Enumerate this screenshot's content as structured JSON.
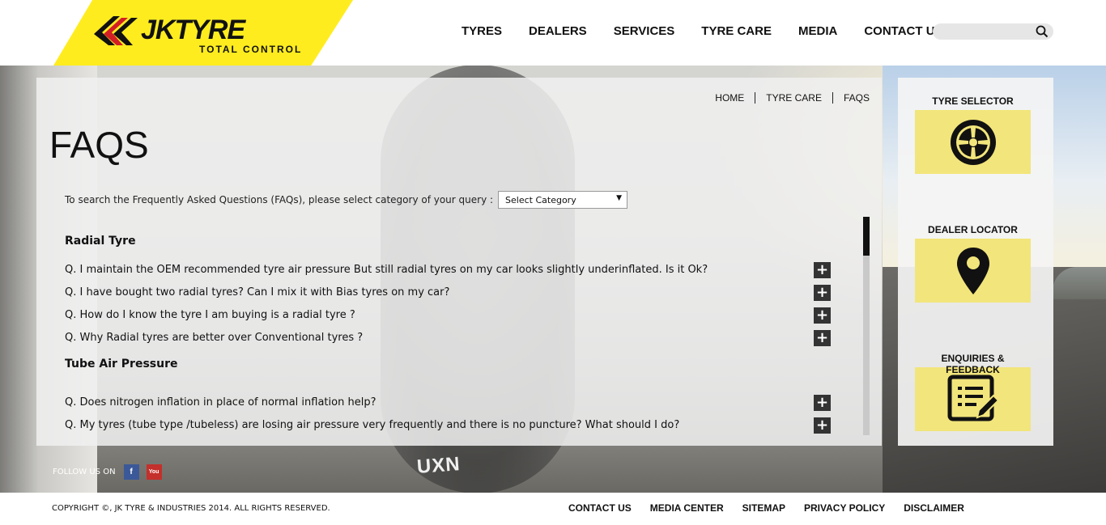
{
  "brand": {
    "name": "JKTYRE",
    "tagline": "TOTAL CONTROL",
    "accent": "#ffec1f"
  },
  "nav": {
    "items": [
      "TYRES",
      "DEALERS",
      "SERVICES",
      "TYRE CARE",
      "MEDIA",
      "CONTACT US"
    ]
  },
  "search": {
    "placeholder": "",
    "icon": "search-icon"
  },
  "breadcrumb": [
    "HOME",
    "TYRE CARE",
    "FAQS"
  ],
  "page": {
    "title": "FAQS",
    "search_prompt": "To search the Frequently Asked Questions (FAQs), please select category of your query :",
    "select_value": "Select Category"
  },
  "faq_sections": [
    {
      "title": "Radial Tyre",
      "questions": [
        "Q. I maintain the OEM recommended tyre air pressure But still radial tyres on my car looks slightly underinflated. Is it Ok?",
        "Q. I have bought two radial tyres? Can I mix it with Bias tyres on my car?",
        "Q. How do I know the tyre I am buying is a radial tyre ?",
        "Q. Why Radial tyres are better over Conventional tyres ?"
      ]
    },
    {
      "title": "Tube Air Pressure",
      "questions": [
        "Q. Does nitrogen inflation in place of normal inflation help?",
        "Q. My tyres (tube type /tubeless) are losing air pressure very frequently and there is no puncture? What should I do?"
      ]
    }
  ],
  "expand_symbol": "+",
  "sidebar": {
    "widgets": [
      {
        "title": "TYRE SELECTOR",
        "icon": "tyre-icon"
      },
      {
        "title": "DEALER LOCATOR",
        "icon": "location-pin-icon"
      },
      {
        "title": "ENQUIRIES & FEEDBACK",
        "icon": "feedback-form-icon"
      }
    ],
    "box_color": "#f2e57b"
  },
  "follow": {
    "label": "FOLLOW US ON",
    "networks": [
      {
        "name": "facebook-icon",
        "glyph": "f",
        "color": "#3b5998"
      },
      {
        "name": "youtube-icon",
        "glyph": "You",
        "color": "#c4302b"
      }
    ]
  },
  "footer": {
    "copyright": "COPYRIGHT ©, JK TYRE & INDUSTRIES 2014. ALL RIGHTS RESERVED.",
    "links": [
      "CONTACT US",
      "MEDIA CENTER",
      "SITEMAP",
      "PRIVACY POLICY",
      "DISCLAIMER"
    ]
  },
  "background": {
    "tyre_label": "UXN"
  }
}
